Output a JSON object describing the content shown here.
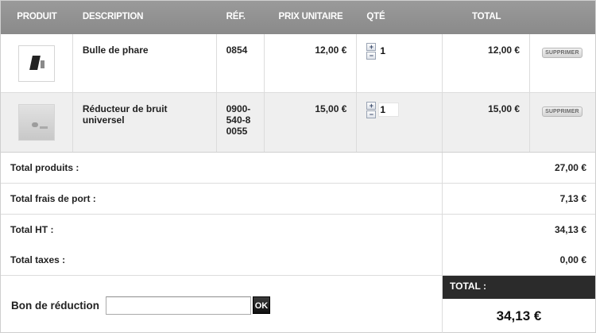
{
  "columns": {
    "product": "PRODUIT",
    "description": "DESCRIPTION",
    "ref": "RÉF.",
    "unit_price": "PRIX UNITAIRE",
    "qty": "QTÉ",
    "total": "TOTAL"
  },
  "items": [
    {
      "description": "Bulle de phare",
      "ref": "0854",
      "unit_price": "12,00 €",
      "qty": "1",
      "total": "12,00 €",
      "delete_label": "SUPPRIMER"
    },
    {
      "description": "Réducteur de bruit universel",
      "ref": "0900-540-80055",
      "unit_price": "15,00 €",
      "qty": "1",
      "total": "15,00 €",
      "delete_label": "SUPPRIMER"
    }
  ],
  "qty_controls": {
    "plus": "+",
    "minus": "−"
  },
  "summary": {
    "products": {
      "label": "Total produits :",
      "value": "27,00 €"
    },
    "shipping": {
      "label": "Total frais de port :",
      "value": "7,13 €"
    },
    "ht": {
      "label": "Total HT :",
      "value": "34,13 €"
    },
    "taxes": {
      "label": "Total taxes :",
      "value": "0,00 €"
    }
  },
  "voucher": {
    "label": "Bon de réduction",
    "value": "",
    "ok_label": "OK"
  },
  "grand_total": {
    "label": "TOTAL :",
    "value": "34,13 €"
  },
  "colors": {
    "header_bg": "#8f8f8f",
    "total_bg": "#2b2b2b",
    "alt_row_bg": "#efefef"
  }
}
